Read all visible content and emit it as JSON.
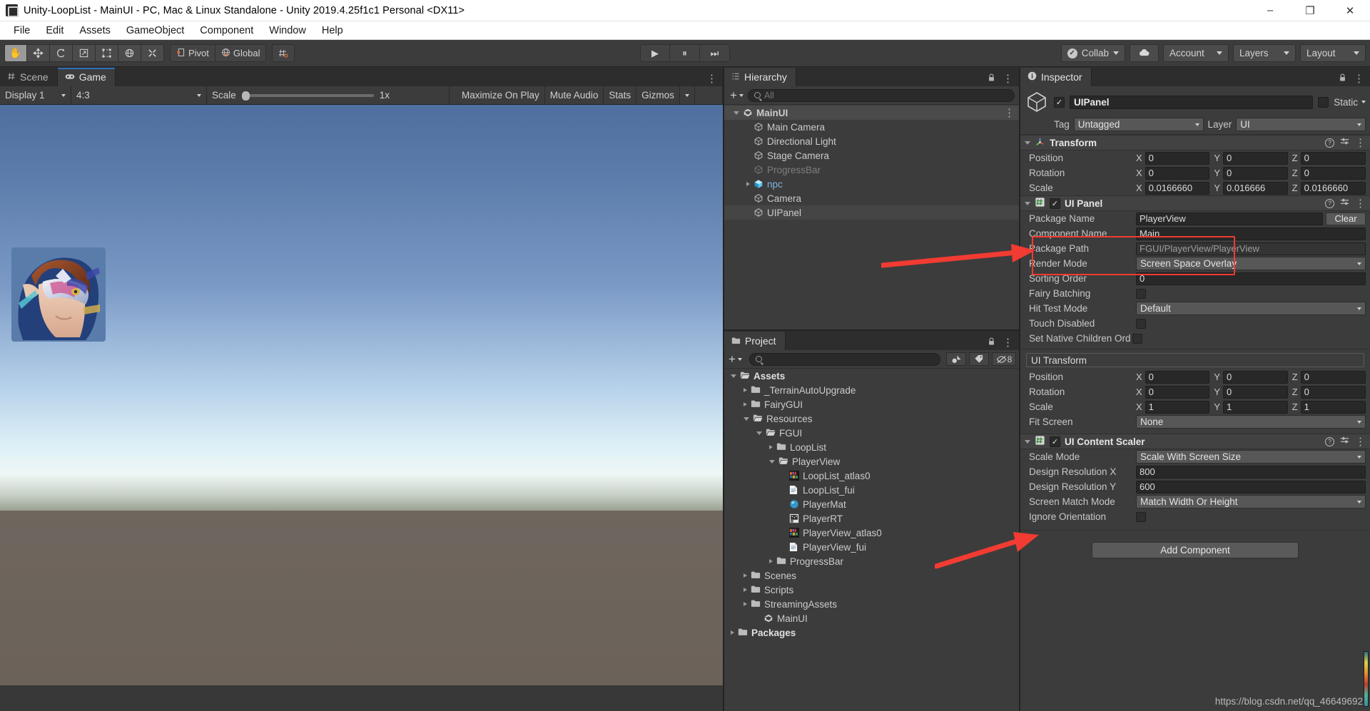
{
  "window": {
    "title": "Unity-LoopList - MainUI - PC, Mac & Linux Standalone - Unity 2019.4.25f1c1 Personal <DX11>",
    "minimize": "–",
    "maximize": "❐",
    "close": "✕"
  },
  "menubar": {
    "items": [
      "File",
      "Edit",
      "Assets",
      "GameObject",
      "Component",
      "Window",
      "Help"
    ]
  },
  "toolbar": {
    "transform_tools": [
      {
        "name": "hand-tool",
        "glyph": "✋",
        "active": true
      },
      {
        "name": "move-tool",
        "glyph": "✥",
        "active": false
      },
      {
        "name": "rotate-tool",
        "glyph": "↻",
        "active": false
      },
      {
        "name": "scale-tool",
        "glyph": "↗",
        "active": false
      },
      {
        "name": "rect-tool",
        "glyph": "⬚",
        "active": false
      },
      {
        "name": "transform-tool",
        "glyph": "⌖",
        "active": false
      },
      {
        "name": "custom-tool",
        "glyph": "⚒",
        "active": false
      }
    ],
    "pivot_label": "Pivot",
    "global_label": "Global",
    "snap_label": "",
    "play": "▶",
    "pause": "⏸",
    "step": "⏭",
    "collab_label": "Collab",
    "cloud_label": "",
    "account_label": "Account",
    "layers_label": "Layers",
    "layout_label": "Layout"
  },
  "game_panel": {
    "tabs": [
      {
        "label": "Scene",
        "icon": "grid-icon",
        "selected": false
      },
      {
        "label": "Game",
        "icon": "gamepad-icon",
        "selected": true
      }
    ],
    "display": "Display 1",
    "aspect": "4:3",
    "scale_label": "Scale",
    "scale_value": "1x",
    "maximize_on_play": "Maximize On Play",
    "mute_audio": "Mute Audio",
    "stats": "Stats",
    "gizmos": "Gizmos"
  },
  "hierarchy": {
    "title": "Hierarchy",
    "search_placeholder": "All",
    "items": [
      {
        "label": "MainUI",
        "depth": 0,
        "arrow": "open",
        "icon": "unity-scene-icon",
        "state": "selected-strong",
        "kebab": true
      },
      {
        "label": "Main Camera",
        "depth": 1,
        "arrow": "none",
        "icon": "gameobject-icon",
        "state": "normal"
      },
      {
        "label": "Directional Light",
        "depth": 1,
        "arrow": "none",
        "icon": "gameobject-icon",
        "state": "normal"
      },
      {
        "label": "Stage Camera",
        "depth": 1,
        "arrow": "none",
        "icon": "gameobject-icon",
        "state": "normal"
      },
      {
        "label": "ProgressBar",
        "depth": 1,
        "arrow": "none",
        "icon": "gameobject-icon",
        "state": "disabled"
      },
      {
        "label": "npc",
        "depth": 1,
        "arrow": "closed",
        "icon": "prefab-icon",
        "state": "prefab"
      },
      {
        "label": "Camera",
        "depth": 1,
        "arrow": "none",
        "icon": "gameobject-icon",
        "state": "normal"
      },
      {
        "label": "UIPanel",
        "depth": 1,
        "arrow": "none",
        "icon": "gameobject-icon",
        "state": "selected-light"
      }
    ]
  },
  "project": {
    "title": "Project",
    "search_placeholder": "",
    "hidden_count": "8",
    "items": [
      {
        "label": "Assets",
        "depth": 0,
        "arrow": "open",
        "icon": "folder-open-icon",
        "bold": true
      },
      {
        "label": "_TerrainAutoUpgrade",
        "depth": 1,
        "arrow": "closed",
        "icon": "folder-icon"
      },
      {
        "label": "FairyGUI",
        "depth": 1,
        "arrow": "closed",
        "icon": "folder-icon"
      },
      {
        "label": "Resources",
        "depth": 1,
        "arrow": "open",
        "icon": "folder-open-icon"
      },
      {
        "label": "FGUI",
        "depth": 2,
        "arrow": "open",
        "icon": "folder-open-icon"
      },
      {
        "label": "LoopList",
        "depth": 3,
        "arrow": "closed",
        "icon": "folder-icon"
      },
      {
        "label": "PlayerView",
        "depth": 3,
        "arrow": "open",
        "icon": "folder-open-icon"
      },
      {
        "label": "LoopList_atlas0",
        "depth": 4,
        "arrow": "none",
        "icon": "texture-icon"
      },
      {
        "label": "LoopList_fui",
        "depth": 4,
        "arrow": "none",
        "icon": "textasset-icon"
      },
      {
        "label": "PlayerMat",
        "depth": 4,
        "arrow": "none",
        "icon": "material-icon"
      },
      {
        "label": "PlayerRT",
        "depth": 4,
        "arrow": "none",
        "icon": "rendertexture-icon"
      },
      {
        "label": "PlayerView_atlas0",
        "depth": 4,
        "arrow": "none",
        "icon": "texture-icon"
      },
      {
        "label": "PlayerView_fui",
        "depth": 4,
        "arrow": "none",
        "icon": "textasset-icon"
      },
      {
        "label": "ProgressBar",
        "depth": 3,
        "arrow": "closed",
        "icon": "folder-icon"
      },
      {
        "label": "Scenes",
        "depth": 1,
        "arrow": "closed",
        "icon": "folder-icon"
      },
      {
        "label": "Scripts",
        "depth": 1,
        "arrow": "closed",
        "icon": "folder-icon"
      },
      {
        "label": "StreamingAssets",
        "depth": 1,
        "arrow": "closed",
        "icon": "folder-icon"
      },
      {
        "label": "MainUI",
        "depth": 2,
        "arrow": "none",
        "icon": "unity-scene-icon"
      },
      {
        "label": "Packages",
        "depth": 0,
        "arrow": "closed",
        "icon": "folder-icon",
        "bold": true
      }
    ]
  },
  "inspector": {
    "title": "Inspector",
    "object_name": "UIPanel",
    "object_enabled": true,
    "static_label": "Static",
    "tag_label": "Tag",
    "tag_value": "Untagged",
    "layer_label": "Layer",
    "layer_value": "UI",
    "transform": {
      "title": "Transform",
      "enabled": null,
      "rows": [
        {
          "label": "Position",
          "x": "0",
          "y": "0",
          "z": "0"
        },
        {
          "label": "Rotation",
          "x": "0",
          "y": "0",
          "z": "0"
        },
        {
          "label": "Scale",
          "x": "0.0166660",
          "y": "0.016666",
          "z": "0.0166660"
        }
      ]
    },
    "ui_panel": {
      "title": "UI Panel",
      "enabled": true,
      "package_name_label": "Package Name",
      "package_name_value": "PlayerView",
      "clear_label": "Clear",
      "component_name_label": "Component Name",
      "component_name_value": "Main",
      "package_path_label": "Package Path",
      "package_path_value": "FGUI/PlayerView/PlayerView",
      "render_mode_label": "Render Mode",
      "render_mode_value": "Screen Space Overlay",
      "sorting_order_label": "Sorting Order",
      "sorting_order_value": "0",
      "fairy_batching_label": "Fairy Batching",
      "fairy_batching_checked": false,
      "hit_test_mode_label": "Hit Test Mode",
      "hit_test_mode_value": "Default",
      "touch_disabled_label": "Touch Disabled",
      "touch_disabled_checked": false,
      "set_native_label": "Set Native Children Ord",
      "set_native_checked": false
    },
    "ui_transform": {
      "title": "UI Transform",
      "rows": [
        {
          "label": "Position",
          "x": "0",
          "y": "0",
          "z": "0"
        },
        {
          "label": "Rotation",
          "x": "0",
          "y": "0",
          "z": "0"
        },
        {
          "label": "Scale",
          "x": "1",
          "y": "1",
          "z": "1"
        }
      ],
      "fit_screen_label": "Fit Screen",
      "fit_screen_value": "None"
    },
    "ui_content_scaler": {
      "title": "UI Content Scaler",
      "enabled": true,
      "scale_mode_label": "Scale Mode",
      "scale_mode_value": "Scale With Screen Size",
      "design_x_label": "Design Resolution X",
      "design_x_value": "800",
      "design_y_label": "Design Resolution Y",
      "design_y_value": "600",
      "screen_match_label": "Screen Match Mode",
      "screen_match_value": "Match Width Or Height",
      "ignore_orientation_label": "Ignore Orientation",
      "ignore_orientation_checked": false
    },
    "add_component_label": "Add Component",
    "watermark": "https://blog.csdn.net/qq_46649692"
  },
  "colors": {
    "accent_blue": "#2c6fbb",
    "annotation_red": "#f23b32",
    "panel_bg": "#3c3c3c",
    "header_bg": "#424242",
    "toolbar_bg": "#3c3c3c"
  }
}
